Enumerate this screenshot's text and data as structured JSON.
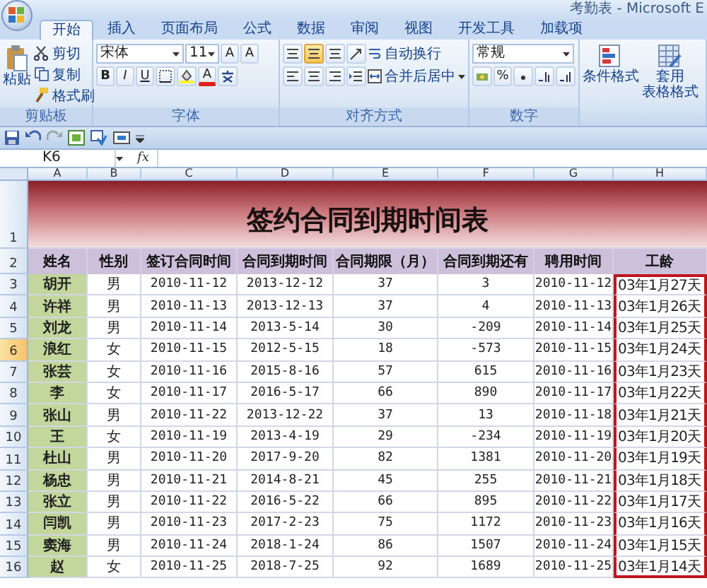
{
  "window": {
    "title": "考勤表 - Microsoft E"
  },
  "tabs": [
    {
      "label": "开始",
      "selected": true
    },
    {
      "label": "插入",
      "selected": false
    },
    {
      "label": "页面布局",
      "selected": false
    },
    {
      "label": "公式",
      "selected": false
    },
    {
      "label": "数据",
      "selected": false
    },
    {
      "label": "审阅",
      "selected": false
    },
    {
      "label": "视图",
      "selected": false
    },
    {
      "label": "开发工具",
      "selected": false
    },
    {
      "label": "加载项",
      "selected": false
    }
  ],
  "ribbon": {
    "clipboard": {
      "label": "剪贴板",
      "paste": "粘贴",
      "cut": "剪切",
      "copy": "复制",
      "painter": "格式刷"
    },
    "font": {
      "label": "字体",
      "name": "宋体",
      "size": "11",
      "grow": "A",
      "shrink": "A",
      "bold": "B",
      "italic": "I",
      "underline": "U",
      "font_color_letter": "A"
    },
    "alignment": {
      "label": "对齐方式",
      "wrap": "自动换行",
      "merge": "合并后居中"
    },
    "number": {
      "label": "数字",
      "format": "常规",
      "percent": "%"
    },
    "styles": {
      "conditional": "条件格式",
      "table_format": [
        "套用",
        "表格格式"
      ]
    }
  },
  "formula_bar": {
    "name_box": "K6",
    "fx": "fx"
  },
  "column_headers": [
    "A",
    "B",
    "C",
    "D",
    "E",
    "F",
    "G",
    "H"
  ],
  "row_headers": [
    {
      "label": "1",
      "selected": false
    },
    {
      "label": "2",
      "selected": false
    },
    {
      "label": "3",
      "selected": false
    },
    {
      "label": "4",
      "selected": false
    },
    {
      "label": "5",
      "selected": false
    },
    {
      "label": "6",
      "selected": true
    },
    {
      "label": "7",
      "selected": false
    },
    {
      "label": "8",
      "selected": false
    },
    {
      "label": "9",
      "selected": false
    },
    {
      "label": "10",
      "selected": false
    },
    {
      "label": "11",
      "selected": false
    },
    {
      "label": "12",
      "selected": false
    },
    {
      "label": "13",
      "selected": false
    },
    {
      "label": "14",
      "selected": false
    },
    {
      "label": "15",
      "selected": false
    },
    {
      "label": "16",
      "selected": false
    }
  ],
  "sheet": {
    "title": "签约合同到期时间表",
    "columns": [
      {
        "header": "姓名",
        "boxed": false
      },
      {
        "header": "性别",
        "boxed": false
      },
      {
        "header": "签订合同时间",
        "boxed": false
      },
      {
        "header": "合同到期时间",
        "boxed": false
      },
      {
        "header": "合同期限（月）",
        "boxed": false
      },
      {
        "header": "合同到期还有",
        "boxed": false
      },
      {
        "header": "聘用时间",
        "boxed": false
      },
      {
        "header": "工龄",
        "boxed": true
      }
    ],
    "rows": [
      [
        "胡开",
        "男",
        "2010-11-12",
        "2013-12-12",
        "37",
        "3",
        "2010-11-12",
        "03年1月27天"
      ],
      [
        "许祥",
        "男",
        "2010-11-13",
        "2013-12-13",
        "37",
        "4",
        "2010-11-13",
        "03年1月26天"
      ],
      [
        "刘龙",
        "男",
        "2010-11-14",
        "2013-5-14",
        "30",
        "-209",
        "2010-11-14",
        "03年1月25天"
      ],
      [
        "浪红",
        "女",
        "2010-11-15",
        "2012-5-15",
        "18",
        "-573",
        "2010-11-15",
        "03年1月24天"
      ],
      [
        "张芸",
        "女",
        "2010-11-16",
        "2015-8-16",
        "57",
        "615",
        "2010-11-16",
        "03年1月23天"
      ],
      [
        "李",
        "女",
        "2010-11-17",
        "2016-5-17",
        "66",
        "890",
        "2010-11-17",
        "03年1月22天"
      ],
      [
        "张山",
        "男",
        "2010-11-22",
        "2013-12-22",
        "37",
        "13",
        "2010-11-18",
        "03年1月21天"
      ],
      [
        "王",
        "女",
        "2010-11-19",
        "2013-4-19",
        "29",
        "-234",
        "2010-11-19",
        "03年1月20天"
      ],
      [
        "杜山",
        "男",
        "2010-11-20",
        "2017-9-20",
        "82",
        "1381",
        "2010-11-20",
        "03年1月19天"
      ],
      [
        "杨忠",
        "男",
        "2010-11-21",
        "2014-8-21",
        "45",
        "255",
        "2010-11-21",
        "03年1月18天"
      ],
      [
        "张立",
        "男",
        "2010-11-22",
        "2016-5-22",
        "66",
        "895",
        "2010-11-22",
        "03年1月17天"
      ],
      [
        "闫凯",
        "男",
        "2010-11-23",
        "2017-2-23",
        "75",
        "1172",
        "2010-11-23",
        "03年1月16天"
      ],
      [
        "窦海",
        "男",
        "2010-11-24",
        "2018-1-24",
        "86",
        "1507",
        "2010-11-24",
        "03年1月15天"
      ],
      [
        "赵",
        "女",
        "2010-11-25",
        "2018-7-25",
        "92",
        "1689",
        "2010-11-25",
        "03年1月14天"
      ]
    ]
  }
}
